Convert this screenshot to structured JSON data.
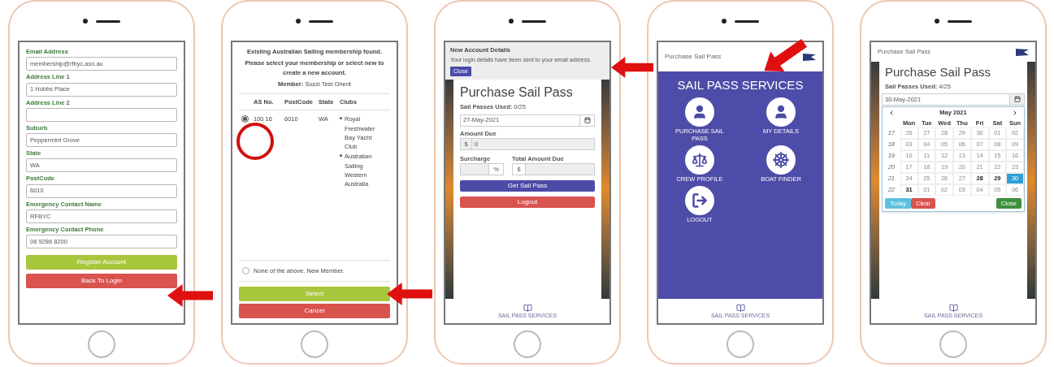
{
  "phones": [
    {
      "kind": "register",
      "fields": [
        {
          "label": "Email Address",
          "value": "membership@rfbyc.asn.au"
        },
        {
          "label": "Address Line 1",
          "value": "1 Hobbs Place"
        },
        {
          "label": "Address Line 2"
        },
        {
          "label": "Suburb",
          "value": "Peppermint Grove"
        },
        {
          "label": "State",
          "value": "WA"
        },
        {
          "label": "PostCode",
          "value": "6010"
        },
        {
          "label": "Emergency Contact Name",
          "value": "RFBYC"
        },
        {
          "label": "Emergency Contact Phone",
          "value": "08 9286 8200"
        }
      ],
      "buttons": [
        {
          "label": "Register Account",
          "kind": "success"
        },
        {
          "label": "Back To Login",
          "kind": "danger"
        }
      ]
    },
    {
      "kind": "membership",
      "heading": "Existing Australian Sailing membership found.",
      "instruction": "Please select your membership or select new to create a new account.",
      "member": "**Member:** Suzzi Test Ghent",
      "columns": [
        "AS No.",
        "PostCode",
        "State",
        "Clubs"
      ],
      "rows": [
        {
          "selected": true,
          "as_no": "100 16",
          "postcode": "6010",
          "state": "WA",
          "clubs": [
            "Royal Freshwater Bay Yacht Club",
            "Australian Sailing Western Australia"
          ]
        }
      ],
      "new_member": {
        "label": "None of the above. New Member.",
        "selected": false
      },
      "buttons": [
        {
          "label": "Select",
          "kind": "success"
        },
        {
          "label": "Cancel",
          "kind": "danger"
        }
      ]
    },
    {
      "kind": "purchase",
      "notice": {
        "title": "New Account Details",
        "message": "Your login details have been sent to your email address.",
        "button": "Close"
      },
      "title": "Purchase Sail Pass",
      "passes_used": "**Sail Passes Used:** 0/25",
      "date": "27-May-2021",
      "amount_label": "Amount Due",
      "currency": "$",
      "amount": "0",
      "surcharge_label": "Surcharge",
      "percent": "%",
      "total_label": "Total Amount Due",
      "total_currency": "$",
      "buttons": [
        {
          "label": "Get Sail Pass",
          "kind": "primary"
        },
        {
          "label": "Logout",
          "kind": "danger"
        }
      ],
      "tab": "SAIL PASS SERVICES"
    },
    {
      "kind": "services",
      "header": "Purchase Sail Pass",
      "title": "SAIL PASS SERVICES",
      "items": [
        {
          "label": "PURCHASE SAIL PASS",
          "kind": "user"
        },
        {
          "label": "MY DETAILS",
          "kind": "user"
        },
        {
          "label": "CREW PROFILE",
          "kind": "crew"
        },
        {
          "label": "BOAT FINDER",
          "kind": "wheel"
        },
        {
          "label": "LOGOUT",
          "kind": "logout"
        }
      ],
      "tab": "SAIL PASS SERVICES"
    },
    {
      "kind": "calendar",
      "header": "Purchase Sail Pass",
      "title": "Purchase Sail Pass",
      "passes_used": "**Sail Passes Used:** 4/25",
      "date": "30-May-2021",
      "month": "May 2021",
      "weekdays": [
        "Mon",
        "Tue",
        "Wed",
        "Thu",
        "Fri",
        "Sat",
        "Sun"
      ],
      "weeks": [
        {
          "number": "17",
          "days": [
            {
              "label": "26",
              "disabled": true,
              "selected": false
            },
            {
              "label": "27",
              "disabled": true,
              "selected": false
            },
            {
              "label": "28",
              "disabled": true,
              "selected": false
            },
            {
              "label": "29",
              "disabled": true,
              "selected": false
            },
            {
              "label": "30",
              "disabled": true,
              "selected": false
            },
            {
              "label": "01",
              "disabled": true,
              "selected": false
            },
            {
              "label": "02",
              "disabled": true,
              "selected": false
            }
          ]
        },
        {
          "number": "18",
          "days": [
            {
              "label": "03",
              "disabled": true,
              "selected": false
            },
            {
              "label": "04",
              "disabled": true,
              "selected": false
            },
            {
              "label": "05",
              "disabled": true,
              "selected": false
            },
            {
              "label": "06",
              "disabled": true,
              "selected": false
            },
            {
              "label": "07",
              "disabled": true,
              "selected": false
            },
            {
              "label": "08",
              "disabled": true,
              "selected": false
            },
            {
              "label": "09",
              "disabled": true,
              "selected": false
            }
          ]
        },
        {
          "number": "19",
          "days": [
            {
              "label": "10",
              "disabled": true,
              "selected": false
            },
            {
              "label": "11",
              "disabled": true,
              "selected": false
            },
            {
              "label": "12",
              "disabled": true,
              "selected": false
            },
            {
              "label": "13",
              "disabled": true,
              "selected": false
            },
            {
              "label": "14",
              "disabled": true,
              "selected": false
            },
            {
              "label": "15",
              "disabled": true,
              "selected": false
            },
            {
              "label": "16",
              "disabled": true,
              "selected": false
            }
          ]
        },
        {
          "number": "20",
          "days": [
            {
              "label": "17",
              "disabled": true,
              "selected": false
            },
            {
              "label": "18",
              "disabled": true,
              "selected": false
            },
            {
              "label": "19",
              "disabled": true,
              "selected": false
            },
            {
              "label": "20",
              "disabled": true,
              "selected": false
            },
            {
              "label": "21",
              "disabled": true,
              "selected": false
            },
            {
              "label": "22",
              "disabled": true,
              "selected": false
            },
            {
              "label": "23",
              "disabled": true,
              "selected": false
            }
          ]
        },
        {
          "number": "21",
          "days": [
            {
              "label": "24",
              "disabled": true,
              "selected": false
            },
            {
              "label": "25",
              "disabled": true,
              "selected": false
            },
            {
              "label": "26",
              "disabled": true,
              "selected": false
            },
            {
              "label": "27",
              "disabled": true,
              "selected": false
            },
            {
              "label": "28",
              "disabled": false,
              "selected": false
            },
            {
              "label": "29",
              "disabled": false,
              "selected": false
            },
            {
              "label": "30",
              "disabled": false,
              "selected": true
            }
          ]
        },
        {
          "number": "22",
          "days": [
            {
              "label": "31",
              "disabled": false,
              "selected": false
            },
            {
              "label": "01",
              "disabled": true,
              "selected": false
            },
            {
              "label": "02",
              "disabled": true,
              "selected": false
            },
            {
              "label": "03",
              "disabled": true,
              "selected": false
            },
            {
              "label": "04",
              "disabled": true,
              "selected": false
            },
            {
              "label": "05",
              "disabled": true,
              "selected": false
            },
            {
              "label": "06",
              "disabled": true,
              "selected": false
            }
          ]
        }
      ],
      "buttons": [
        {
          "label": "Today",
          "kind": "info"
        },
        {
          "label": "Clear",
          "kind": "danger"
        },
        {
          "label": "Close",
          "kind": "confirm"
        }
      ],
      "tab": "SAIL PASS SERVICES"
    }
  ]
}
